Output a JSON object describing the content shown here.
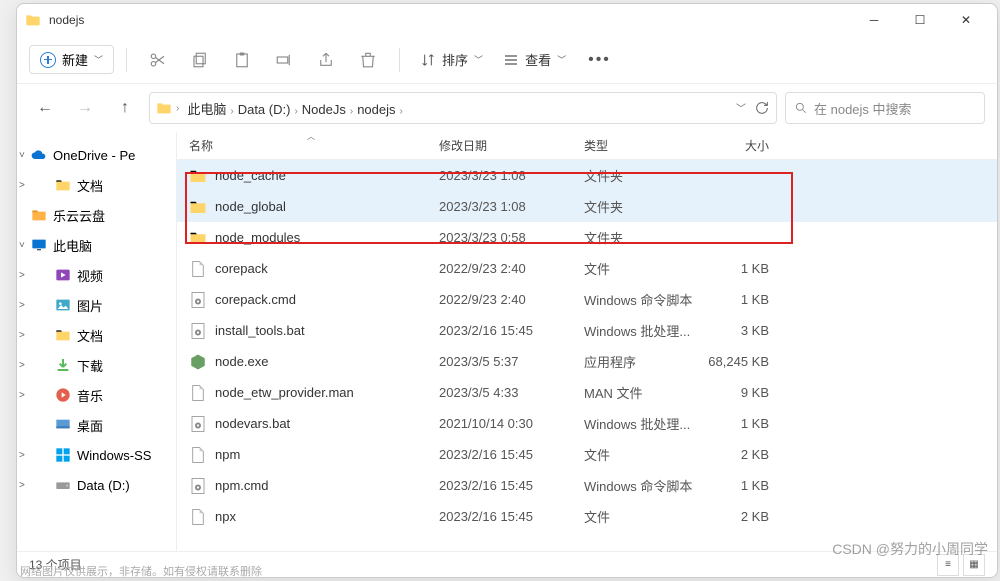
{
  "window": {
    "title": "nodejs"
  },
  "toolbar": {
    "new_label": "新建",
    "sort_label": "排序",
    "view_label": "查看"
  },
  "breadcrumbs": [
    "此电脑",
    "Data (D:)",
    "NodeJs",
    "nodejs"
  ],
  "search": {
    "placeholder": "在 nodejs 中搜索"
  },
  "columns": {
    "name": "名称",
    "date": "修改日期",
    "type": "类型",
    "size": "大小"
  },
  "sidebar": [
    {
      "label": "OneDrive - Pe",
      "icon": "cloud",
      "chevron": "˅",
      "indent": false
    },
    {
      "label": "文档",
      "icon": "folder",
      "chevron": ">",
      "indent": true
    },
    {
      "label": "乐云云盘",
      "icon": "lecloud",
      "chevron": "",
      "indent": false
    },
    {
      "label": "此电脑",
      "icon": "monitor",
      "chevron": "˅",
      "indent": false
    },
    {
      "label": "视频",
      "icon": "purple",
      "chevron": ">",
      "indent": true
    },
    {
      "label": "图片",
      "icon": "pic",
      "chevron": ">",
      "indent": true
    },
    {
      "label": "文档",
      "icon": "folder",
      "chevron": ">",
      "indent": true
    },
    {
      "label": "下载",
      "icon": "down",
      "chevron": ">",
      "indent": true
    },
    {
      "label": "音乐",
      "icon": "music",
      "chevron": ">",
      "indent": true
    },
    {
      "label": "桌面",
      "icon": "desk",
      "chevron": "",
      "indent": true
    },
    {
      "label": "Windows-SS",
      "icon": "win",
      "chevron": ">",
      "indent": true
    },
    {
      "label": "Data (D:)",
      "icon": "drive",
      "chevron": ">",
      "indent": true
    }
  ],
  "files": [
    {
      "name": "node_cache",
      "date": "2023/3/23 1:08",
      "type": "文件夹",
      "size": "",
      "icon": "folder",
      "selected": true
    },
    {
      "name": "node_global",
      "date": "2023/3/23 1:08",
      "type": "文件夹",
      "size": "",
      "icon": "folder",
      "selected": true
    },
    {
      "name": "node_modules",
      "date": "2023/3/23 0:58",
      "type": "文件夹",
      "size": "",
      "icon": "folder",
      "selected": false
    },
    {
      "name": "corepack",
      "date": "2022/9/23 2:40",
      "type": "文件",
      "size": "1 KB",
      "icon": "file",
      "selected": false
    },
    {
      "name": "corepack.cmd",
      "date": "2022/9/23 2:40",
      "type": "Windows 命令脚本",
      "size": "1 KB",
      "icon": "gear",
      "selected": false
    },
    {
      "name": "install_tools.bat",
      "date": "2023/2/16 15:45",
      "type": "Windows 批处理...",
      "size": "3 KB",
      "icon": "gear",
      "selected": false
    },
    {
      "name": "node.exe",
      "date": "2023/3/5 5:37",
      "type": "应用程序",
      "size": "68,245 KB",
      "icon": "node",
      "selected": false
    },
    {
      "name": "node_etw_provider.man",
      "date": "2023/3/5 4:33",
      "type": "MAN 文件",
      "size": "9 KB",
      "icon": "file",
      "selected": false
    },
    {
      "name": "nodevars.bat",
      "date": "2021/10/14 0:30",
      "type": "Windows 批处理...",
      "size": "1 KB",
      "icon": "gear",
      "selected": false
    },
    {
      "name": "npm",
      "date": "2023/2/16 15:45",
      "type": "文件",
      "size": "2 KB",
      "icon": "file",
      "selected": false
    },
    {
      "name": "npm.cmd",
      "date": "2023/2/16 15:45",
      "type": "Windows 命令脚本",
      "size": "1 KB",
      "icon": "gear",
      "selected": false
    },
    {
      "name": "npx",
      "date": "2023/2/16 15:45",
      "type": "文件",
      "size": "2 KB",
      "icon": "file",
      "selected": false
    }
  ],
  "status": {
    "count": "13 个项目"
  },
  "watermark": "CSDN @努力的小周同学",
  "footer": "网络图片仅供展示，非存储。如有侵权请联系删除"
}
